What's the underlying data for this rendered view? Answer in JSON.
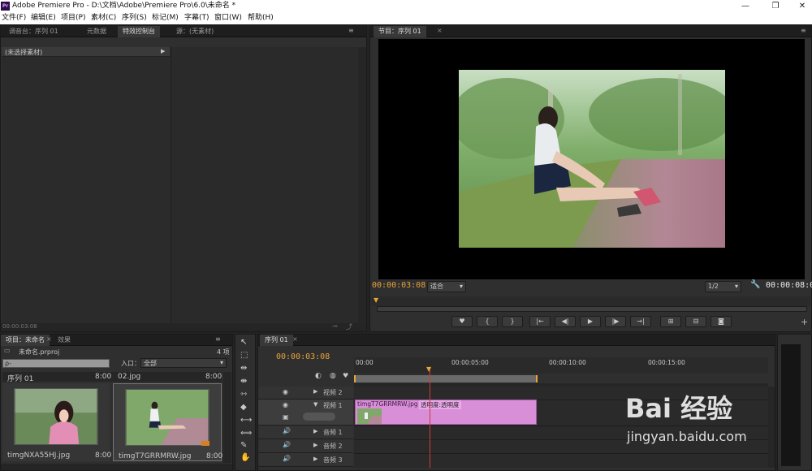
{
  "app": {
    "title": "Adobe Premiere Pro - D:\\文档\\Adobe\\Premiere Pro\\6.0\\未命名 *",
    "logo_text": "Pr"
  },
  "menu": [
    "文件(F)",
    "编辑(E)",
    "项目(P)",
    "素材(C)",
    "序列(S)",
    "标记(M)",
    "字幕(T)",
    "窗口(W)",
    "帮助(H)"
  ],
  "source_panel": {
    "tabs": [
      "调音台：序列 01",
      "元数据",
      "特效控制台",
      "源：(无素材)"
    ],
    "active_tab": 2,
    "no_clip": "(未选择素材)",
    "timecode": "00:00:03:08"
  },
  "program": {
    "tab": "节目：序列 01",
    "timecode": "00:00:03:08",
    "fit": "适合",
    "quality": "1/2",
    "duration": "00:00:08:00"
  },
  "transport": [
    "♥",
    "{",
    "}",
    "|←",
    "◀|",
    "▶",
    "|▶",
    "→|",
    "⊞",
    "⊟",
    "◙"
  ],
  "project": {
    "tabs": [
      "项目：未命名",
      "效果"
    ],
    "file": "未命名.prproj",
    "count": "4 项",
    "search_placeholder": "ρ-",
    "in_label": "入口：",
    "in_value": "全部",
    "items": [
      {
        "name": "序列 01",
        "dur": "8:00"
      },
      {
        "name": "02.jpg",
        "dur": "8:00"
      },
      {
        "name": "timgNXA55HJ.jpg",
        "dur": "8:00"
      },
      {
        "name": "timgT7GRRMRW.jpg",
        "dur": "8:00"
      }
    ]
  },
  "timeline": {
    "tab": "序列 01",
    "timecode": "00:00:03:08",
    "ruler": [
      "00:00",
      "00:00:05:00",
      "00:00:10:00",
      "00:00:15:00"
    ],
    "tracks": [
      {
        "name": "视频 2"
      },
      {
        "name": "视频 1"
      },
      {
        "name": "音频 1"
      },
      {
        "name": "音频 2"
      },
      {
        "name": "音频 3"
      }
    ],
    "clip": {
      "name": "timgT7GRRMRW.jpg",
      "effect": "透明度:透明度"
    }
  },
  "watermark": {
    "brand": "Bai 经验",
    "url": "jingyan.baidu.com"
  },
  "colors": {
    "accent": "#e8a33a",
    "clip": "#d88fd8",
    "panel": "#2f2f2f"
  }
}
